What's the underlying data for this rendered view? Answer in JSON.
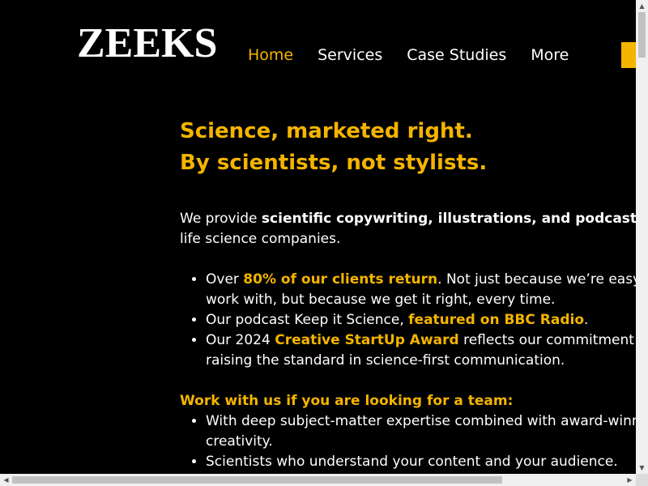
{
  "brand": {
    "logo": "ZEEKS"
  },
  "nav": {
    "items": [
      {
        "label": "Home",
        "active": true
      },
      {
        "label": "Services",
        "active": false
      },
      {
        "label": "Case Studies",
        "active": false
      },
      {
        "label": "More",
        "active": false
      }
    ]
  },
  "hero": {
    "headline_line1": "Science, marketed right.",
    "headline_line2": "By scientists, not stylists.",
    "intro_prefix": "We provide ",
    "intro_bold": "scientific copywriting, illustrations, and podcasts",
    "intro_suffix": " for life science companies."
  },
  "stats": [
    {
      "pre": "Over ",
      "bold": "80% of our clients return",
      "post": ". Not just because we’re easy to work with, but because we get it right, every time."
    },
    {
      "pre": "Our podcast Keep it Science, ",
      "bold": "featured on BBC Radio",
      "post": "."
    },
    {
      "pre": "Our 2024 ",
      "bold": "Creative StartUp Award",
      "post": " reflects our commitment to raising the standard in science-first communication."
    }
  ],
  "work_with_us": {
    "heading": "Work with us if you are looking for a team:",
    "items": [
      "With deep subject-matter expertise combined with award-winning creativity.",
      "Scientists who understand your content and your audience."
    ]
  },
  "colors": {
    "accent": "#f4b400",
    "background": "#000000",
    "text": "#ffffff"
  },
  "scrollbars": {
    "up_icon": "▲",
    "down_icon": "▼",
    "left_icon": "◀",
    "right_icon": "▶"
  }
}
